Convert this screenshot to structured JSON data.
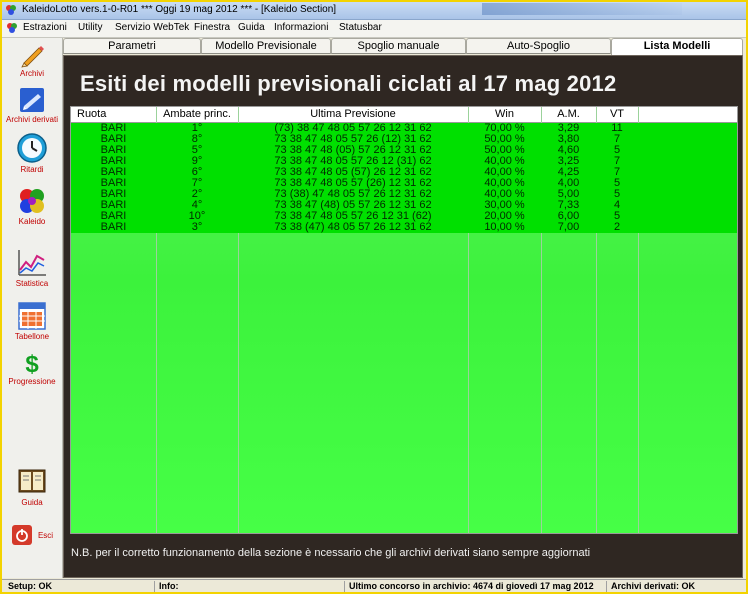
{
  "window": {
    "title": "KaleidoLotto vers.1-0-R01  ***  Oggi 19 mag 2012  ***   - [Kaleido Section]"
  },
  "menubar": {
    "items": [
      "Estrazioni",
      "Utility",
      "Servizio WebTek",
      "Finestra",
      "Guida",
      "Informazioni",
      "Statusbar"
    ]
  },
  "sidebar": {
    "items": [
      {
        "label": "Archivi",
        "icon": "pencil-icon"
      },
      {
        "label": "Archivi derivati",
        "icon": "folder-icon"
      },
      {
        "label": "Ritardi",
        "icon": "clock-icon"
      },
      {
        "label": "Kaleido",
        "icon": "kaleido-icon"
      },
      {
        "label": "Statistica",
        "icon": "chart-icon"
      },
      {
        "label": "Tabellone",
        "icon": "table-icon"
      },
      {
        "label": "Progressione",
        "icon": "dollar-icon"
      },
      {
        "label": "Guida",
        "icon": "book-icon"
      },
      {
        "label": "Esci",
        "icon": "power-icon"
      }
    ]
  },
  "tabs": [
    {
      "label": "Parametri"
    },
    {
      "label": "Modello Previsionale"
    },
    {
      "label": "Spoglio manuale"
    },
    {
      "label": "Auto-Spoglio"
    },
    {
      "label": "Lista Modelli"
    }
  ],
  "active_tab": "Lista Modelli",
  "heading": "Esiti dei modelli previsionali ciclati al 17 mag 2012",
  "table": {
    "columns": [
      "Ruota",
      "Ambate princ.",
      "Ultima Previsione",
      "Win",
      "A.M.",
      "VT",
      ""
    ],
    "rows": [
      [
        "BARI",
        "1°",
        "(73) 38 47 48 05 57 26 12 31 62",
        "70,00 %",
        "3,29",
        "11"
      ],
      [
        "BARI",
        "8°",
        "73 38 47 48 05 57 26 (12) 31 62",
        "50,00 %",
        "3,80",
        "7"
      ],
      [
        "BARI",
        "5°",
        "73 38 47 48 (05) 57 26 12 31 62",
        "50,00 %",
        "4,60",
        "5"
      ],
      [
        "BARI",
        "9°",
        "73 38 47 48 05 57 26 12 (31) 62",
        "40,00 %",
        "3,25",
        "7"
      ],
      [
        "BARI",
        "6°",
        "73 38 47 48 05 (57) 26 12 31 62",
        "40,00 %",
        "4,25",
        "7"
      ],
      [
        "BARI",
        "7°",
        "73 38 47 48 05 57 (26) 12 31 62",
        "40,00 %",
        "4,00",
        "5"
      ],
      [
        "BARI",
        "2°",
        "73 (38) 47 48 05 57 26 12 31 62",
        "40,00 %",
        "5,00",
        "5"
      ],
      [
        "BARI",
        "4°",
        "73 38 47 (48) 05 57 26 12 31 62",
        "30,00 %",
        "7,33",
        "4"
      ],
      [
        "BARI",
        "10°",
        "73 38 47 48 05 57 26 12 31 (62)",
        "20,00 %",
        "6,00",
        "5"
      ],
      [
        "BARI",
        "3°",
        "73 38 (47) 48 05 57 26 12 31 62",
        "10,00 %",
        "7,00",
        "2"
      ]
    ]
  },
  "note": "N.B. per il corretto funzionamento della sezione è ncessario che gli archivi derivati siano sempre aggiornati",
  "statusbar": {
    "setup": "Setup: OK",
    "info": "Info:",
    "ultimo": "Ultimo concorso in archivio: 4674 di giovedì 17 mag 2012",
    "archivi": "Archivi derivati: OK"
  },
  "colors": {
    "row_highlight": "#00e000",
    "grid_background": "#46ff46",
    "content_background": "#2f2722",
    "frame": "#f3d300"
  }
}
